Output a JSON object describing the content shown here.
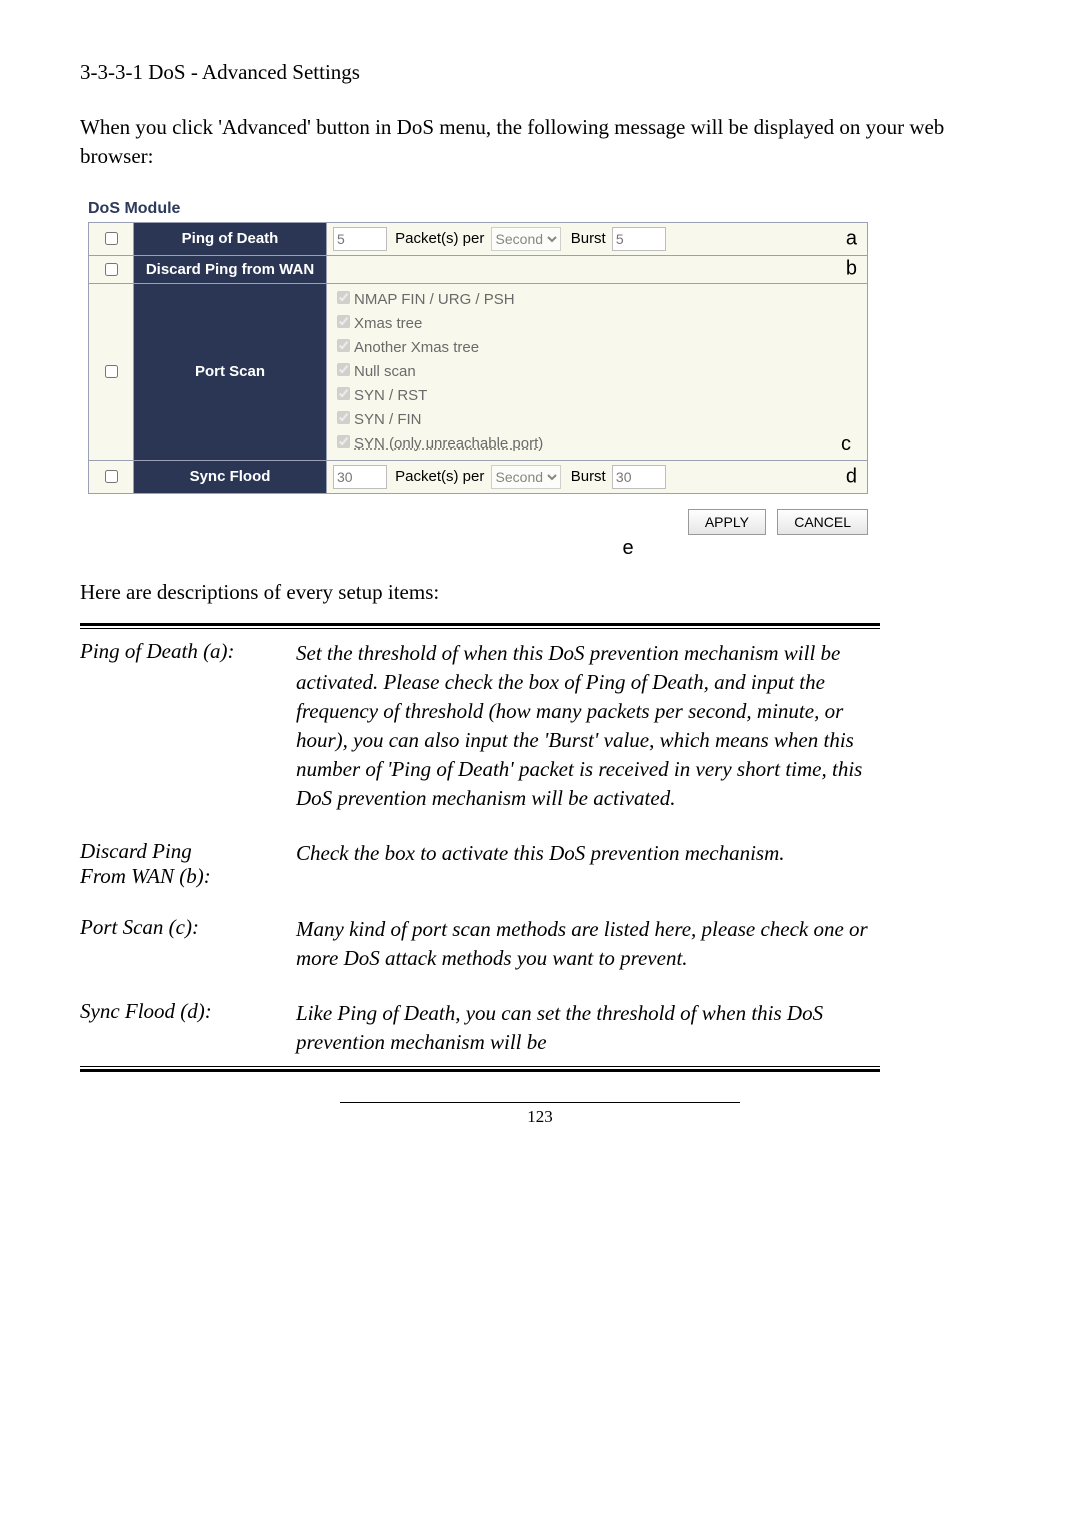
{
  "heading": "3-3-3-1 DoS - Advanced Settings",
  "intro": "When you click 'Advanced' button in DoS menu, the following message will be displayed on your web browser:",
  "module_title": "DoS Module",
  "rows": {
    "ping_of_death": {
      "label": "Ping of Death",
      "value": "5",
      "packets_label": "Packet(s) per",
      "unit": "Second",
      "burst_label": "Burst",
      "burst_value": "5",
      "letter": "a"
    },
    "discard_ping": {
      "label": "Discard Ping from WAN",
      "letter": "b"
    },
    "port_scan": {
      "label": "Port Scan",
      "options": [
        "NMAP FIN / URG / PSH",
        "Xmas tree",
        "Another Xmas tree",
        "Null scan",
        "SYN / RST",
        "SYN / FIN",
        "SYN (only unreachable port)"
      ],
      "letter": "c"
    },
    "sync_flood": {
      "label": "Sync Flood",
      "value": "30",
      "packets_label": "Packet(s) per",
      "unit": "Second",
      "burst_label": "Burst",
      "burst_value": "30",
      "letter": "d"
    }
  },
  "buttons": {
    "apply": "APPLY",
    "cancel": "CANCEL"
  },
  "e_letter": "e",
  "desc_line": "Here are descriptions of every setup items:",
  "items": [
    {
      "label": "Ping of Death (a):",
      "desc": "Set the threshold of when this DoS prevention mechanism will be activated. Please check the box of Ping of Death, and input the frequency of threshold (how many packets per second, minute, or hour), you can also input the 'Burst' value, which means when this number of 'Ping of Death' packet is received in very short time, this DoS prevention mechanism will be activated."
    },
    {
      "label": "Discard Ping\nFrom WAN (b):",
      "desc": "Check the box to activate this DoS prevention mechanism."
    },
    {
      "label": "Port Scan (c):",
      "desc": "Many kind of port scan methods are listed here, please check one or more DoS attack methods you want to prevent."
    },
    {
      "label": "Sync Flood (d):",
      "desc": "Like Ping of Death, you can set the threshold of when this DoS prevention mechanism will be"
    }
  ],
  "page_number": "123"
}
